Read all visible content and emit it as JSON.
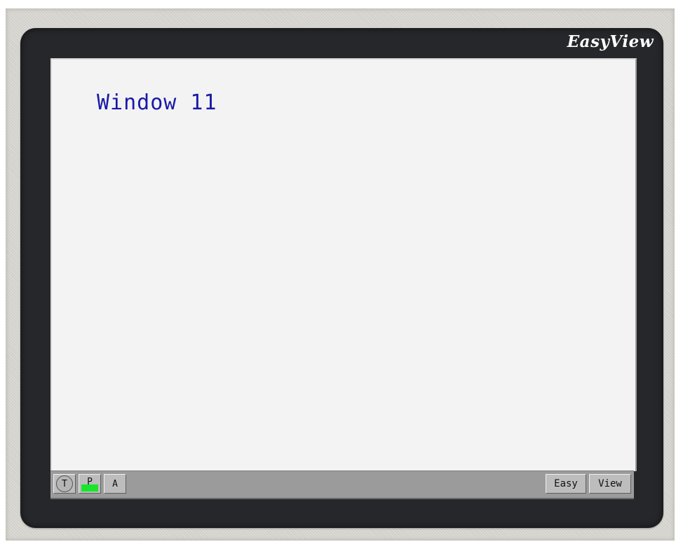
{
  "device": {
    "brand": "EasyView"
  },
  "screen": {
    "window_title": "Window 11"
  },
  "taskbar": {
    "buttons": [
      {
        "label": "T",
        "icon": "circle-t-icon"
      },
      {
        "label": "P",
        "indicator_color": "#19e62b"
      },
      {
        "label": "A"
      }
    ],
    "right_buttons": [
      {
        "label": "Easy"
      },
      {
        "label": "View"
      }
    ]
  },
  "colors": {
    "bezel": "#26272b",
    "screen_bg": "#f3f3f3",
    "title_text": "#1a1aa8",
    "taskbar_bg": "#9b9b9b"
  }
}
